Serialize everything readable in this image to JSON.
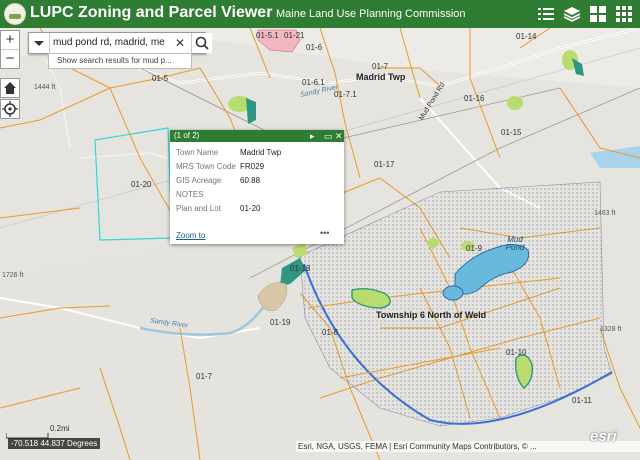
{
  "header": {
    "app_title": "LUPC Zoning and Parcel Viewer",
    "agency": "Maine Land Use Planning Commission",
    "buttons": [
      "list-icon",
      "layers-icon",
      "basemap-gallery-icon",
      "grid-icon"
    ],
    "color": "#2e7d32"
  },
  "search": {
    "value": "mud pond rd, madrid, me",
    "suggestion": "Show search results for mud p..."
  },
  "map_controls": {
    "zoom_in": "+",
    "zoom_out": "−"
  },
  "popup": {
    "title": "(1 of 2)",
    "fields": [
      {
        "label": "Town Name",
        "value": "Madrid Twp"
      },
      {
        "label": "MRS Town Code",
        "value": "FR029"
      },
      {
        "label": "GIS Acreage",
        "value": "60.88"
      },
      {
        "label": "NOTES",
        "value": ""
      },
      {
        "label": "Plan and Lot",
        "value": "01-20"
      }
    ],
    "zoom_to": "Zoom to",
    "more": "•••"
  },
  "map_labels": {
    "parcels": [
      "01-5.1",
      "01-21",
      "01-6",
      "01-7",
      "01-14",
      "01-6.1",
      "01-7.1",
      "01-16",
      "01-15",
      "01-17",
      "01-20",
      "01-5",
      "01-8",
      "01-9",
      "01-7",
      "01-10",
      "01-11",
      "01-18",
      "01-19"
    ],
    "places": [
      "Madrid Twp",
      "Township 6 North of Weld",
      "Mud Pond"
    ],
    "roads": [
      "Mud Pond Rd",
      "Sandy River",
      "Sandy River"
    ],
    "elevations": [
      "1444 ft",
      "1463 ft",
      "1726 ft",
      "1328 ft"
    ]
  },
  "scale": "0.2mi",
  "coordinates": "-70.518 44.837 Degrees",
  "attribution": "Esri, NGA, USGS, FEMA | Esri Community Maps Contributors, © ...",
  "esri_logo": "esri"
}
